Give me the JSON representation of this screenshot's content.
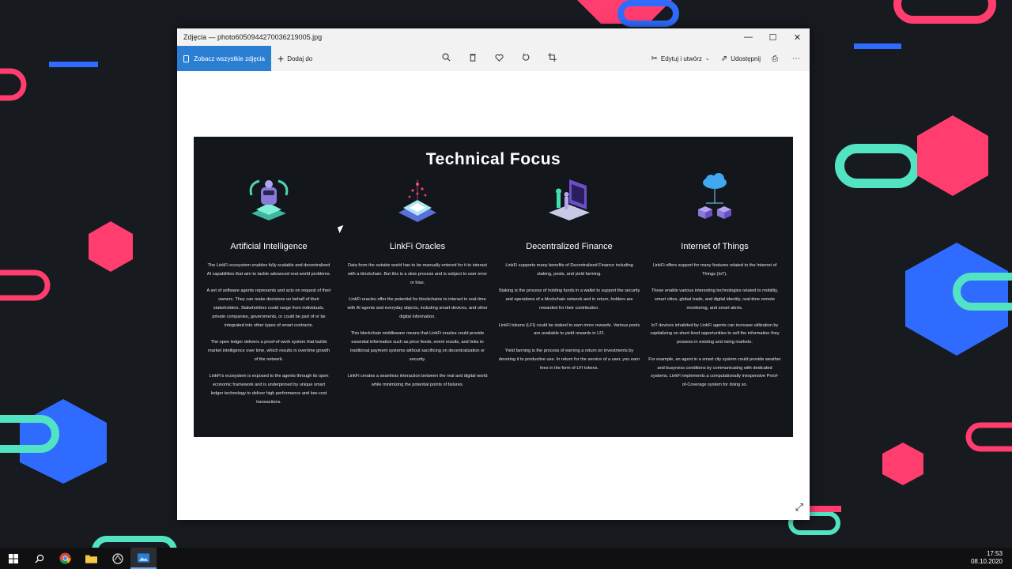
{
  "window": {
    "title": "Zdjęcia — photo6050944270036219005.jpg",
    "controls": {
      "minimize": "—",
      "maximize": "☐",
      "close": "✕"
    }
  },
  "toolbar": {
    "see_all_label": "Zobacz wszystkie zdjęcia",
    "add_label": "Dodaj do",
    "edit_label": "Edytuj i utwórz",
    "share_label": "Udostępnij",
    "icons": [
      "zoom-icon",
      "delete-icon",
      "favorite-icon",
      "rotate-icon",
      "crop-icon",
      "print-icon",
      "more-icon"
    ]
  },
  "slide": {
    "title": "Technical Focus",
    "columns": [
      {
        "heading": "Artificial Intelligence",
        "icon": "robot-icon",
        "paragraphs": [
          "The LinkFi ecosystem enables fully scalable and decentralized AI capabilities that aim to tackle advanced real-world problems.",
          "A set of software agents represents and acts on request of their owners. They can make decisions on behalf of their stakeholders. Stakeholders could range from individuals, private companies, governments, or could be part of or be integrated into other types of smart contracts.",
          "The open ledger delivers a proof-of-work system that builds market intelligence over time, which results in overtime growth of the network.",
          "LinkFi's ecosystem is exposed to the agents through its open economic framework and is underpinned by unique smart ledger technology to deliver high performance and low-cost transactions."
        ]
      },
      {
        "heading": "LinkFi Oracles",
        "icon": "oracle-chip-icon",
        "paragraphs": [
          "Data from the outside world has to be manually entered for it to interact with a blockchain. But this is a slow process and is subject to user error or bias.",
          "LinkFi oracles offer the potential for blockchains to interact in real-time with AI agents and everyday objects, including smart devices, and other digital information.",
          "This blockchain middleware means that LinkFi oracles could provide essential information such as price feeds, event results, and links to traditional payment systems without sacrificing on decentralization or security.",
          "LinkFi creates a seamless interaction between the real and digital world while minimizing the potential points of failures."
        ]
      },
      {
        "heading": "Decentralized Finance",
        "icon": "finance-dashboard-icon",
        "paragraphs": [
          "LinkFi supports many benefits of Decentralized Finance including staking, pools, and yield farming.",
          "Staking is the process of holding funds in a wallet to support the security and operations of a blockchain network and in return, holders are rewarded for their contribution.",
          "LinkFi tokens (LFI) could be staked to earn more rewards. Various pools are available to yield rewards in LFI.",
          "Yield farming is the process of earning a return on investments by devoting it to productive use. In return for the service of a user, you earn fees in the form of LFI tokens."
        ]
      },
      {
        "heading": "Internet of Things",
        "icon": "cloud-network-icon",
        "paragraphs": [
          "LinkFi offers support for many features related to the Internet of Things (IoT).",
          "These enable various interesting technologies related to mobility, smart cities, global trade, and digital identity, real-time remote monitoring, and smart alerts.",
          "IoT devices inhabited by LinkFi agents can increase utilization by capitalizing on short-lived opportunities to sell the information they possess in existing and rising markets.",
          "For example, an agent in a smart city system could provide weather and busyness conditions by communicating with dedicated systems. LinkFi implements a computationally inexpensive Proof-of-Coverage system for doing so."
        ]
      }
    ]
  },
  "taskbar": {
    "apps": [
      "start-icon",
      "search-icon",
      "chrome-icon",
      "file-explorer-icon",
      "app-icon",
      "photos-icon"
    ],
    "time": "17:53",
    "date": "08.10.2020"
  }
}
